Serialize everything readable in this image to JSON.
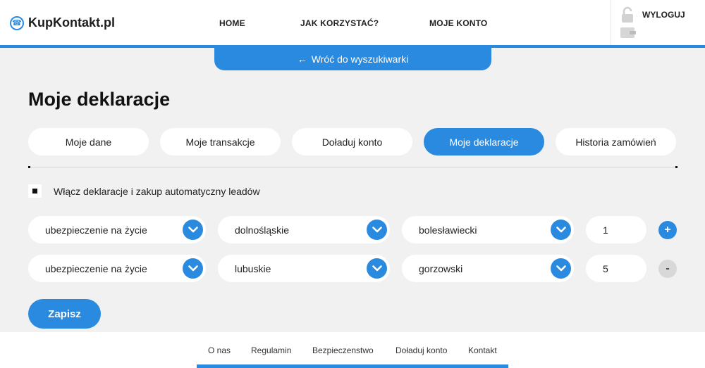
{
  "header": {
    "logo": "KupKontakt.pl",
    "nav": [
      "HOME",
      "JAK KORZYSTAĆ?",
      "MOJE KONTO"
    ],
    "logout_label": "WYLOGUJ"
  },
  "back_link": "Wróć do wyszukiwarki",
  "page_title": "Moje deklaracje",
  "tabs": [
    {
      "label": "Moje dane",
      "active": false
    },
    {
      "label": "Moje transakcje",
      "active": false
    },
    {
      "label": "Doładuj konto",
      "active": false
    },
    {
      "label": "Moje deklaracje",
      "active": true
    },
    {
      "label": "Historia zamówień",
      "active": false
    }
  ],
  "auto_checkbox": {
    "label": "Włącz deklaracje i zakup automatyczny leadów",
    "checked": true
  },
  "declarations": [
    {
      "category": "ubezpieczenie na życie",
      "region": "dolnośląskie",
      "district": "bolesławiecki",
      "quantity": "1",
      "action": "+"
    },
    {
      "category": "ubezpieczenie na życie",
      "region": "lubuskie",
      "district": "gorzowski",
      "quantity": "5",
      "action": "-"
    }
  ],
  "save_label": "Zapisz",
  "footer": {
    "links": [
      "O nas",
      "Regulamin",
      "Bezpieczenstwo",
      "Doładuj konto",
      "Kontakt"
    ]
  },
  "colors": {
    "accent": "#2a8ae0",
    "background": "#f1f1f1"
  }
}
